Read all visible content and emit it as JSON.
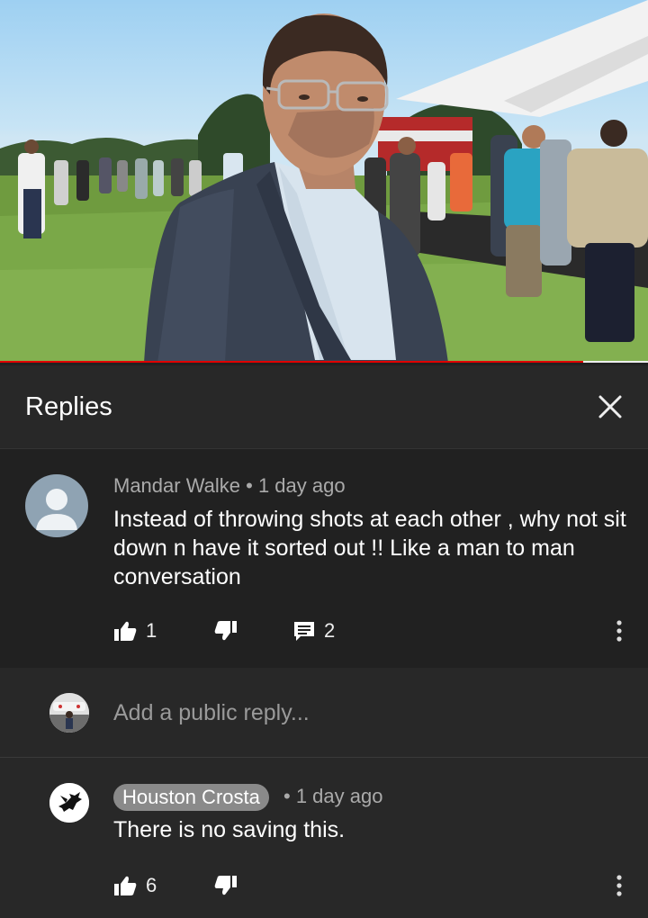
{
  "video": {
    "progress_fraction": 0.9,
    "progress_color": "#e00000"
  },
  "replies_panel": {
    "title": "Replies",
    "close_icon": "close-icon"
  },
  "comment": {
    "author": "Mandar Walke",
    "separator": " • ",
    "time": "1 day ago",
    "text": "Instead of throwing shots at each other , why not sit down n have it sorted out !! Like a man to man conversation",
    "like_count": "1",
    "reply_count": "2",
    "icons": [
      "like-icon",
      "dislike-icon",
      "comment-icon",
      "more-vert-icon"
    ]
  },
  "add_reply": {
    "placeholder": "Add a public reply..."
  },
  "reply": {
    "author": "Houston Crosta",
    "separator": "•",
    "time": "1 day ago",
    "text": "There is no saving this.",
    "like_count": "6"
  }
}
